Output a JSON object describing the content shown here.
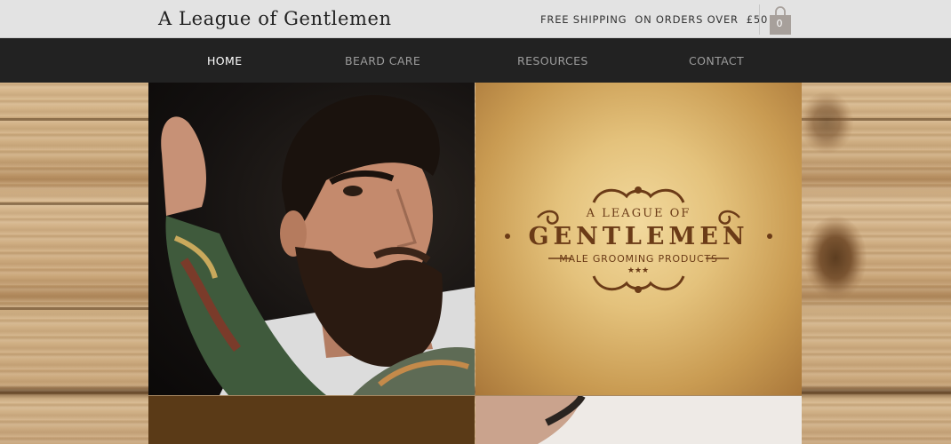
{
  "header": {
    "site_title": "A League of Gentlemen",
    "shipping_text": "FREE SHIPPING  ON ORDERS OVER  £50",
    "cart_count": "0"
  },
  "nav": {
    "items": [
      {
        "label": "HOME",
        "active": true
      },
      {
        "label": "BEARD CARE",
        "active": false
      },
      {
        "label": "RESOURCES",
        "active": false
      },
      {
        "label": "CONTACT",
        "active": false
      }
    ]
  },
  "logo": {
    "top_line": "A LEAGUE OF",
    "main": "GENTLEMEN",
    "subtitle": "MALE GROOMING PRODUCTS"
  },
  "colors": {
    "nav_bg": "#222222",
    "topbar_bg": "#e3e3e3",
    "cart_icon": "#a7a09b",
    "logo_brown": "#6b3b17",
    "brown_panel": "#5a3a17"
  },
  "icons": {
    "cart": "shopping-bag-icon"
  }
}
